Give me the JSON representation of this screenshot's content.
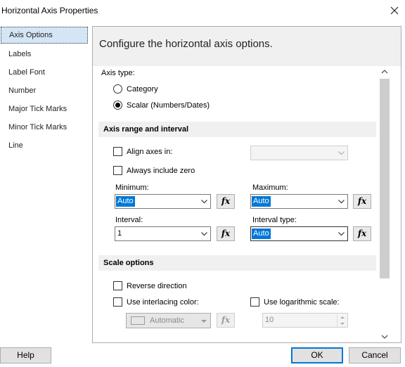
{
  "window": {
    "title": "Horizontal Axis Properties"
  },
  "nav": {
    "items": [
      {
        "label": "Axis Options",
        "active": true
      },
      {
        "label": "Labels"
      },
      {
        "label": "Label Font"
      },
      {
        "label": "Number"
      },
      {
        "label": "Major Tick Marks"
      },
      {
        "label": "Minor Tick Marks"
      },
      {
        "label": "Line"
      }
    ]
  },
  "panel": {
    "title": "Configure the horizontal axis options.",
    "axis_type": {
      "label": "Axis type:",
      "options": [
        {
          "label": "Category",
          "selected": false
        },
        {
          "label": "Scalar (Numbers/Dates)",
          "selected": true
        }
      ]
    },
    "range_section": {
      "header": "Axis range and interval",
      "align_axes": {
        "label": "Align axes  in:",
        "checked": false,
        "dropdown_value": ""
      },
      "always_zero": {
        "label": "Always include zero",
        "checked": false
      },
      "minimum": {
        "label": "Minimum:",
        "value": "Auto"
      },
      "maximum": {
        "label": "Maximum:",
        "value": "Auto"
      },
      "interval": {
        "label": "Interval:",
        "value": "1"
      },
      "interval_type": {
        "label": "Interval type:",
        "value": "Auto"
      },
      "fx_label": "fx"
    },
    "scale_section": {
      "header": "Scale options",
      "reverse": {
        "label": "Reverse direction",
        "checked": false
      },
      "interlacing": {
        "label": "Use interlacing color:",
        "checked": false,
        "color_value": "Automatic"
      },
      "logarithmic": {
        "label": "Use logarithmic scale:",
        "checked": false,
        "base_value": "10"
      }
    }
  },
  "footer": {
    "help_label": "Help",
    "ok_label": "OK",
    "cancel_label": "Cancel"
  }
}
